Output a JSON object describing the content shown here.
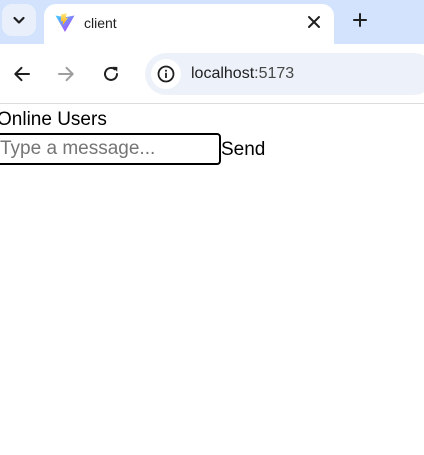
{
  "browser": {
    "tab": {
      "title": "client",
      "favicon": "vite-logo-icon"
    },
    "tab_icons": {
      "tab_search": "chevron-down-icon",
      "close": "close-icon",
      "new_tab": "plus-icon"
    },
    "toolbar": {
      "back": "arrow-left-icon",
      "forward": "arrow-right-icon",
      "reload": "reload-icon",
      "site_info": "info-icon"
    },
    "address": {
      "host": "localhost",
      "port": ":5173"
    },
    "colors": {
      "tabstrip": "#d3e3fd",
      "omnibox": "#edf1f9"
    }
  },
  "page": {
    "heading": "Online Users",
    "message_input": {
      "placeholder": "Type a message...",
      "value": ""
    },
    "send_label": "Send"
  }
}
